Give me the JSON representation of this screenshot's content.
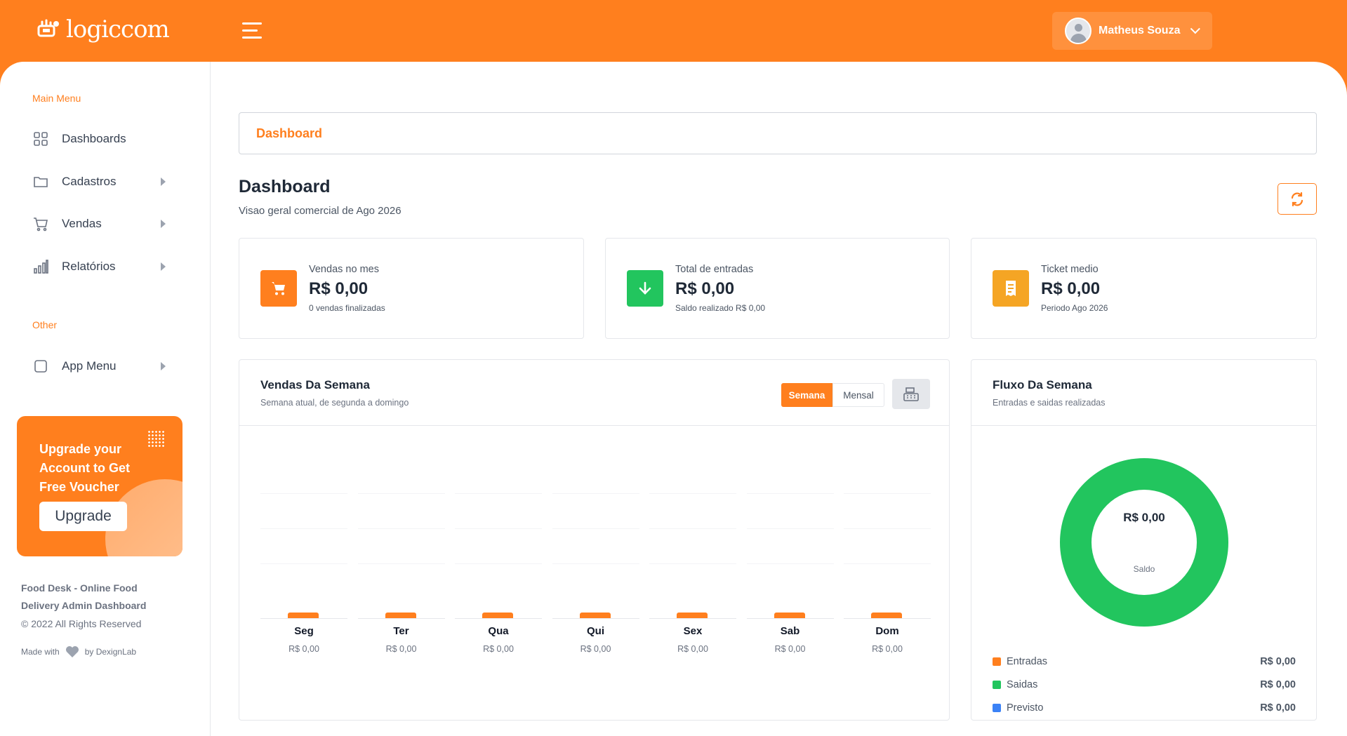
{
  "header": {
    "logo_text": "logiccom",
    "user_name": "Matheus Souza"
  },
  "sidebar": {
    "section_main": "Main Menu",
    "items": [
      {
        "label": "Dashboards",
        "icon": "grid-icon"
      },
      {
        "label": "Cadastros",
        "icon": "folder-icon"
      },
      {
        "label": "Vendas",
        "icon": "cart-icon"
      },
      {
        "label": "Relatórios",
        "icon": "bar-chart-icon"
      }
    ],
    "section_other": "Other",
    "other_items": [
      {
        "label": "App Menu",
        "icon": "square-icon"
      }
    ],
    "promo": {
      "message": "Upgrade your Account to Get Free Voucher",
      "button": "Upgrade"
    },
    "footer": {
      "line1": "Food Desk - Online Food",
      "line2": "Delivery Admin Dashboard",
      "copyright": "© 2022 All Rights Reserved",
      "made_with": "Made with",
      "by": "by DexignLab"
    }
  },
  "breadcrumb": "Dashboard",
  "page": {
    "title": "Dashboard",
    "subtitle": "Visao geral comercial de Ago 2026"
  },
  "stats": [
    {
      "label": "Vendas no mes",
      "value": "R$ 0,00",
      "note": "0 vendas finalizadas",
      "color": "#ff7f1e",
      "icon": "cart-icon"
    },
    {
      "label": "Total de entradas",
      "value": "R$ 0,00",
      "note": "Saldo realizado R$ 0,00",
      "color": "#22c55e",
      "icon": "arrow-down-icon"
    },
    {
      "label": "Ticket medio",
      "value": "R$ 0,00",
      "note": "Periodo Ago 2026",
      "color": "#f5a524",
      "icon": "receipt-icon"
    }
  ],
  "sales_chart": {
    "title": "Vendas Da Semana",
    "subtitle": "Semana atual, de segunda a domingo",
    "toggle_week": "Semana",
    "toggle_month": "Mensal"
  },
  "flow_chart": {
    "title": "Fluxo Da Semana",
    "subtitle": "Entradas e saidas realizadas",
    "center_value": "R$ 0,00",
    "center_label": "Saldo",
    "legend": [
      {
        "name": "Entradas",
        "value": "R$ 0,00",
        "color": "#ff7f1e"
      },
      {
        "name": "Saidas",
        "value": "R$ 0,00",
        "color": "#22c55e"
      },
      {
        "name": "Previsto",
        "value": "R$ 0,00",
        "color": "#3b82f6"
      }
    ]
  },
  "chart_data": [
    {
      "type": "bar",
      "categories": [
        "Seg",
        "Ter",
        "Qua",
        "Qui",
        "Sex",
        "Sab",
        "Dom"
      ],
      "values": [
        0,
        0,
        0,
        0,
        0,
        0,
        0
      ],
      "value_labels": [
        "R$ 0,00",
        "R$ 0,00",
        "R$ 0,00",
        "R$ 0,00",
        "R$ 0,00",
        "R$ 0,00",
        "R$ 0,00"
      ],
      "title": "Vendas Da Semana"
    },
    {
      "type": "pie",
      "categories": [
        "Entradas",
        "Saidas",
        "Previsto"
      ],
      "values": [
        0,
        0,
        0
      ],
      "title": "Fluxo Da Semana"
    }
  ]
}
